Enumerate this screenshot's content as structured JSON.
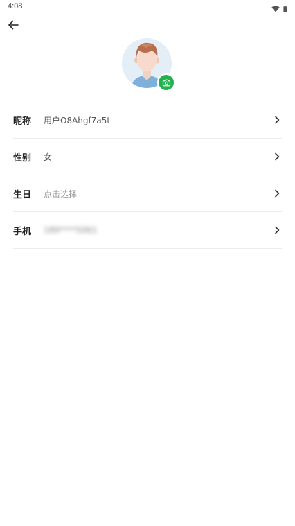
{
  "status_bar": {
    "time": "4:08",
    "icons": [
      "wifi-icon",
      "battery-icon"
    ]
  },
  "header": {
    "back_icon": "arrow-left-icon"
  },
  "avatar": {
    "badge_icon": "camera-icon",
    "badge_color": "#22b14c"
  },
  "profile": {
    "nickname": {
      "label": "昵称",
      "value": "用户O8Ahgf7a5t"
    },
    "gender": {
      "label": "性别",
      "value": "女"
    },
    "birthday": {
      "label": "生日",
      "value": "点击选择"
    },
    "phone": {
      "label": "手机",
      "value": "189****5061"
    }
  }
}
